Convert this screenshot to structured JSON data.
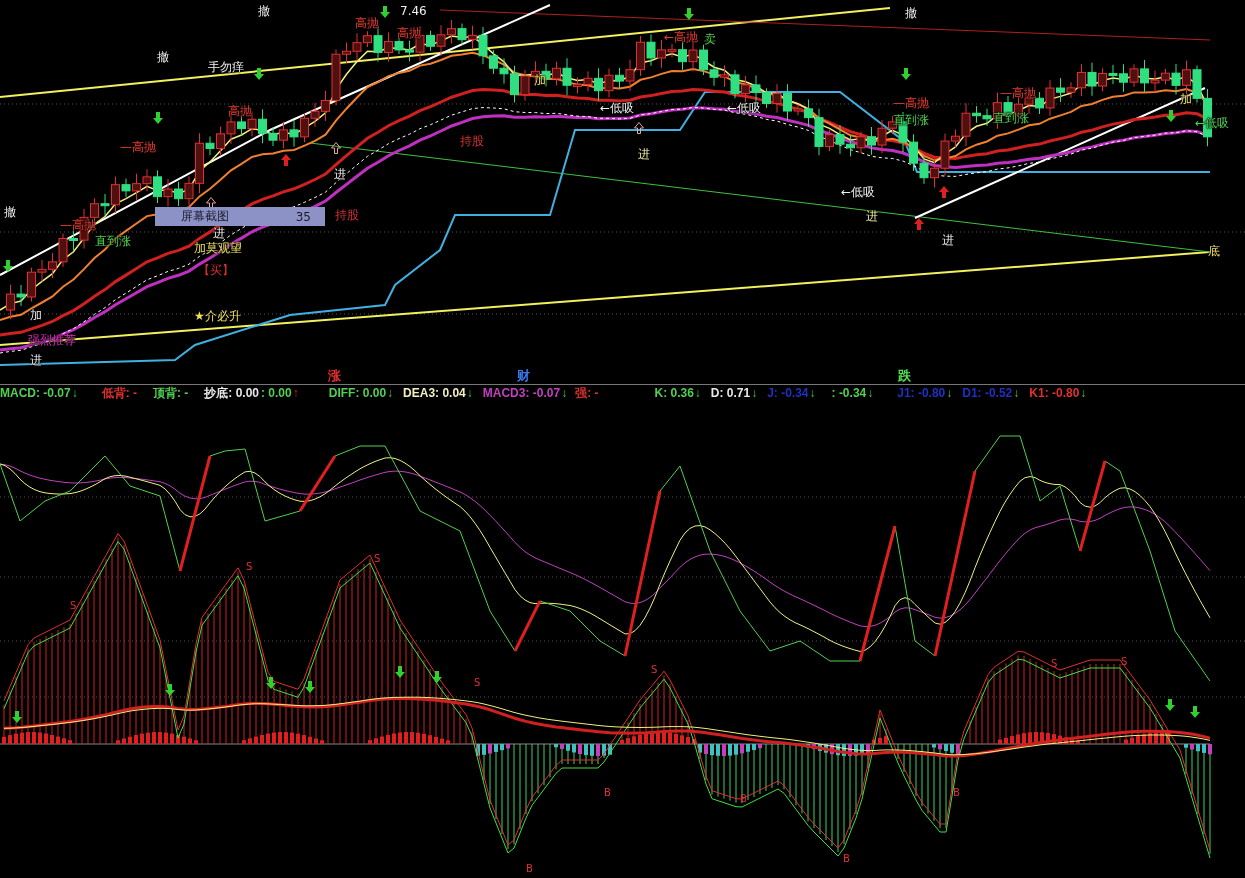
{
  "main_chart": {
    "annotations": [
      {
        "text": "撤",
        "kind": "note"
      },
      {
        "text": "撤",
        "kind": "note"
      },
      {
        "text": "手勿痒",
        "kind": "note"
      },
      {
        "text": "—高抛",
        "kind": "sell"
      },
      {
        "text": "撤",
        "kind": "note"
      },
      {
        "text": "持股",
        "kind": "hold"
      },
      {
        "text": "—高抛",
        "kind": "sell"
      },
      {
        "text": "直到涨",
        "kind": "rise"
      },
      {
        "text": "进",
        "kind": "note"
      },
      {
        "text": "加莫观望",
        "kind": "watch"
      },
      {
        "text": "【买】",
        "kind": "hold"
      },
      {
        "text": "加",
        "kind": "note"
      },
      {
        "text": "★介必升",
        "kind": "watch"
      },
      {
        "text": "强烈推荐",
        "kind": "recommend"
      },
      {
        "text": "进",
        "kind": "note"
      },
      {
        "text": "进",
        "kind": "note"
      },
      {
        "text": "高抛",
        "kind": "sell"
      },
      {
        "text": "高抛",
        "kind": "sell"
      },
      {
        "text": "高抛",
        "kind": "sell"
      },
      {
        "text": "7.46",
        "kind": "note"
      },
      {
        "text": "持股",
        "kind": "hold"
      },
      {
        "text": "加",
        "kind": "watch"
      },
      {
        "text": "←低吸",
        "kind": "note"
      },
      {
        "text": "进",
        "kind": "entry"
      },
      {
        "text": "←高抛",
        "kind": "sell"
      },
      {
        "text": "卖",
        "kind": "rise"
      },
      {
        "text": "←低吸",
        "kind": "note"
      },
      {
        "text": "←低吸",
        "kind": "note"
      },
      {
        "text": "进",
        "kind": "entry"
      },
      {
        "text": "—高抛",
        "kind": "sell"
      },
      {
        "text": "直到涨",
        "kind": "rise"
      },
      {
        "text": "—高抛",
        "kind": "sell"
      },
      {
        "text": "直到涨",
        "kind": "rise"
      },
      {
        "text": "进",
        "kind": "note"
      },
      {
        "text": "←低吸",
        "kind": "rise"
      },
      {
        "text": "加",
        "kind": "watch"
      },
      {
        "text": "底",
        "kind": "watch"
      },
      {
        "text": "撤",
        "kind": "note"
      }
    ]
  },
  "screenshot_tooltip": {
    "label": "屏幕截图",
    "count": "35"
  },
  "section_markers": [
    {
      "text": "涨",
      "color": "#e03030"
    },
    {
      "text": "财",
      "color": "#3a78f0"
    },
    {
      "text": "跌",
      "color": "#50e050"
    }
  ],
  "readouts": [
    {
      "text": "MACD: -0.07",
      "color": "#50d050",
      "arrow": "↓",
      "rising": false
    },
    {
      "text": "低背: -",
      "color": "#e03030"
    },
    {
      "text": "顶背: -",
      "color": "#50d050"
    },
    {
      "text": "抄底: 0.00",
      "color": "#e8e8e8"
    },
    {
      "text": ": 0.00",
      "color": "#50d050",
      "arrow": "↑",
      "rising": true
    },
    {
      "text": "DIFF: 0.00",
      "color": "#50d050",
      "arrow": "↓",
      "rising": false
    },
    {
      "text": "DEA3: 0.04",
      "color": "#f0f0c0",
      "arrow": "↓",
      "rising": false
    },
    {
      "text": "MACD3: -0.07",
      "color": "#c040c0",
      "arrow": "↓",
      "rising": false
    },
    {
      "text": "强: -",
      "color": "#e03030"
    },
    {
      "text": "K: 0.36",
      "color": "#50d050",
      "arrow": "↓",
      "rising": false
    },
    {
      "text": "D: 0.71",
      "color": "#e8e8e8",
      "arrow": "↓",
      "rising": false
    },
    {
      "text": "J: -0.34",
      "color": "#2030c0",
      "arrow": "↓",
      "rising": false
    },
    {
      "text": ": -0.34",
      "color": "#50d050",
      "arrow": "↓",
      "rising": false
    },
    {
      "text": "J1: -0.80",
      "color": "#2030c0",
      "arrow": "↓",
      "rising": false
    },
    {
      "text": "D1: -0.52",
      "color": "#2030c0",
      "arrow": "↓",
      "rising": false
    },
    {
      "text": "K1: -0.80",
      "color": "#e03030",
      "arrow": "↓",
      "rising": false
    }
  ],
  "oscillator": {
    "signals": [
      {
        "text": "S"
      },
      {
        "text": "S"
      },
      {
        "text": "S"
      },
      {
        "text": "S"
      },
      {
        "text": "S"
      },
      {
        "text": "S"
      },
      {
        "text": "S"
      },
      {
        "text": "B"
      },
      {
        "text": "B"
      },
      {
        "text": "B"
      },
      {
        "text": "B"
      },
      {
        "text": "B"
      }
    ]
  }
}
